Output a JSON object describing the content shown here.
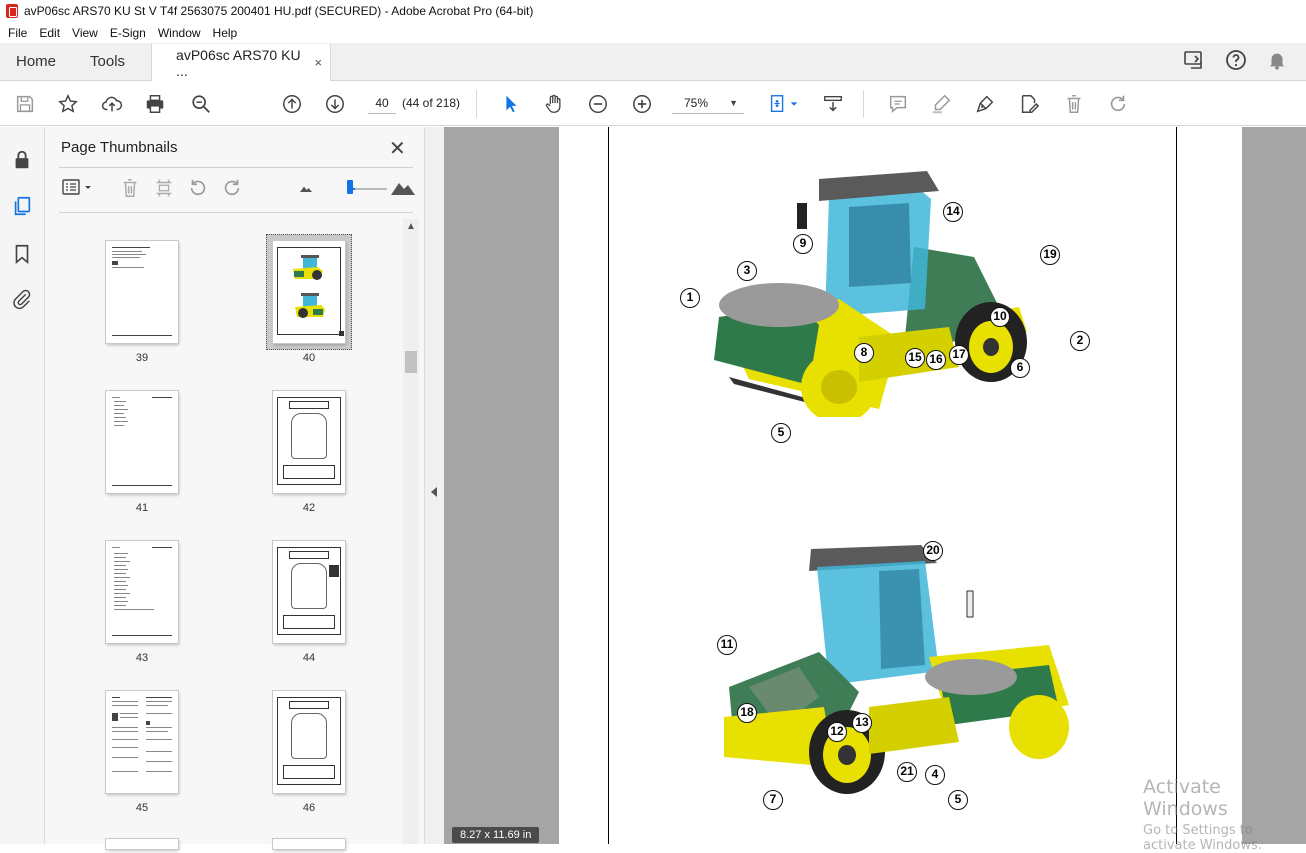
{
  "window": {
    "title": "avP06sc ARS70 KU St V T4f 2563075 200401 HU.pdf (SECURED) - Adobe Acrobat Pro (64-bit)"
  },
  "menu": [
    "File",
    "Edit",
    "View",
    "E-Sign",
    "Window",
    "Help"
  ],
  "tabs": {
    "home": "Home",
    "tools": "Tools",
    "document": "avP06sc ARS70 KU ...",
    "close": "×"
  },
  "toolbar": {
    "page_number": "40",
    "page_count": "(44 of 218)",
    "zoom": "75%"
  },
  "thumbnails_panel": {
    "title": "Page Thumbnails",
    "close": "✕",
    "pages": [
      {
        "label": "39"
      },
      {
        "label": "40",
        "selected": true
      },
      {
        "label": "41"
      },
      {
        "label": "42"
      },
      {
        "label": "43"
      },
      {
        "label": "44"
      },
      {
        "label": "45"
      },
      {
        "label": "46"
      }
    ]
  },
  "document": {
    "page_size": "8.27 x 11.69 in",
    "top_figure_callouts": [
      "1",
      "2",
      "3",
      "5",
      "6",
      "8",
      "9",
      "10",
      "14",
      "15",
      "16",
      "17",
      "19"
    ],
    "bottom_figure_callouts": [
      "4",
      "5",
      "7",
      "11",
      "12",
      "13",
      "18",
      "20",
      "21"
    ]
  },
  "watermark": {
    "line1": "Activate Windows",
    "line2": "Go to Settings to activate Windows."
  },
  "colors": {
    "machine_yellow": "#e8e000",
    "machine_green": "#2e7a4a",
    "cab_blue": "#3fb6d8",
    "accent_blue": "#1473e6",
    "pdf_red": "#d7261e"
  }
}
